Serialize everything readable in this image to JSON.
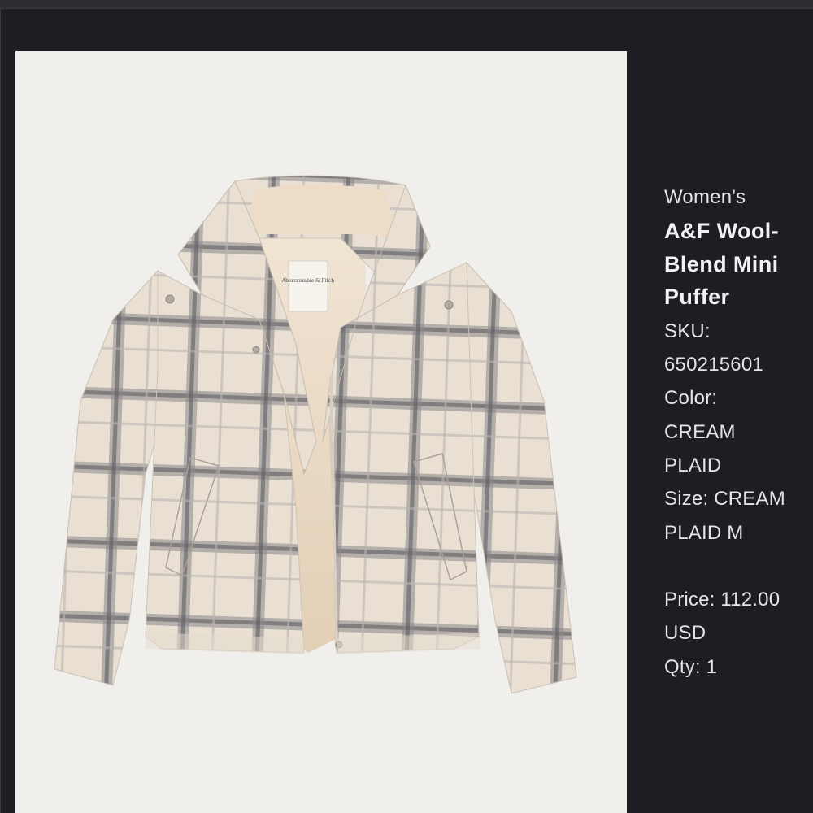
{
  "product": {
    "category": "Women's",
    "title_lines": [
      "A&F Wool-",
      "Blend Mini",
      "Puffer"
    ],
    "image_label": "Abercrombie & Fitch"
  },
  "details": {
    "sku_label": "SKU:",
    "sku_value": "650215601",
    "color_label": "Color:",
    "color_value_lines": [
      "CREAM",
      "PLAID"
    ],
    "size_line1": "Size: CREAM",
    "size_line2": "PLAID M",
    "price_line1": "Price: 112.00",
    "price_line2": "USD",
    "qty_line": "Qty: 1"
  },
  "colors": {
    "background": "#1d1e24",
    "photo_background": "#f1efec",
    "jacket_base": "#e9e0d3",
    "plaid_stripe": "#6f6d72",
    "lining": "#ecdcc8",
    "text": "#e4e4e8"
  }
}
